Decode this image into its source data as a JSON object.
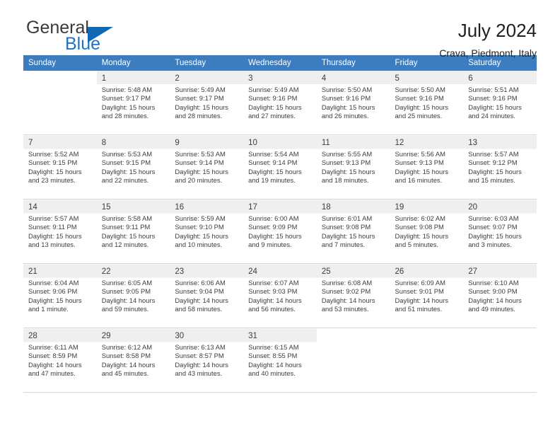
{
  "brand": {
    "name_top": "General",
    "name_bottom": "Blue",
    "triangle_color": "#1268b3",
    "blue_color": "#1c74c4"
  },
  "header": {
    "title": "July 2024",
    "subtitle": "Crava, Piedmont, Italy"
  },
  "theme": {
    "header_row_bg": "#3b7dbf",
    "header_row_text": "#ffffff",
    "daynum_band_bg": "#efefef",
    "grid_line": "#d8d8d8"
  },
  "weekdays": [
    "Sunday",
    "Monday",
    "Tuesday",
    "Wednesday",
    "Thursday",
    "Friday",
    "Saturday"
  ],
  "labels": {
    "sunrise_prefix": "Sunrise:",
    "sunset_prefix": "Sunset:",
    "daylight_prefix": "Daylight:"
  },
  "weeks": [
    [
      {
        "day": "",
        "l1": "",
        "l2": "",
        "l3": "",
        "l4": ""
      },
      {
        "day": "1",
        "l1": "Sunrise: 5:48 AM",
        "l2": "Sunset: 9:17 PM",
        "l3": "Daylight: 15 hours",
        "l4": "and 28 minutes."
      },
      {
        "day": "2",
        "l1": "Sunrise: 5:49 AM",
        "l2": "Sunset: 9:17 PM",
        "l3": "Daylight: 15 hours",
        "l4": "and 28 minutes."
      },
      {
        "day": "3",
        "l1": "Sunrise: 5:49 AM",
        "l2": "Sunset: 9:16 PM",
        "l3": "Daylight: 15 hours",
        "l4": "and 27 minutes."
      },
      {
        "day": "4",
        "l1": "Sunrise: 5:50 AM",
        "l2": "Sunset: 9:16 PM",
        "l3": "Daylight: 15 hours",
        "l4": "and 26 minutes."
      },
      {
        "day": "5",
        "l1": "Sunrise: 5:50 AM",
        "l2": "Sunset: 9:16 PM",
        "l3": "Daylight: 15 hours",
        "l4": "and 25 minutes."
      },
      {
        "day": "6",
        "l1": "Sunrise: 5:51 AM",
        "l2": "Sunset: 9:16 PM",
        "l3": "Daylight: 15 hours",
        "l4": "and 24 minutes."
      }
    ],
    [
      {
        "day": "7",
        "l1": "Sunrise: 5:52 AM",
        "l2": "Sunset: 9:15 PM",
        "l3": "Daylight: 15 hours",
        "l4": "and 23 minutes."
      },
      {
        "day": "8",
        "l1": "Sunrise: 5:53 AM",
        "l2": "Sunset: 9:15 PM",
        "l3": "Daylight: 15 hours",
        "l4": "and 22 minutes."
      },
      {
        "day": "9",
        "l1": "Sunrise: 5:53 AM",
        "l2": "Sunset: 9:14 PM",
        "l3": "Daylight: 15 hours",
        "l4": "and 20 minutes."
      },
      {
        "day": "10",
        "l1": "Sunrise: 5:54 AM",
        "l2": "Sunset: 9:14 PM",
        "l3": "Daylight: 15 hours",
        "l4": "and 19 minutes."
      },
      {
        "day": "11",
        "l1": "Sunrise: 5:55 AM",
        "l2": "Sunset: 9:13 PM",
        "l3": "Daylight: 15 hours",
        "l4": "and 18 minutes."
      },
      {
        "day": "12",
        "l1": "Sunrise: 5:56 AM",
        "l2": "Sunset: 9:13 PM",
        "l3": "Daylight: 15 hours",
        "l4": "and 16 minutes."
      },
      {
        "day": "13",
        "l1": "Sunrise: 5:57 AM",
        "l2": "Sunset: 9:12 PM",
        "l3": "Daylight: 15 hours",
        "l4": "and 15 minutes."
      }
    ],
    [
      {
        "day": "14",
        "l1": "Sunrise: 5:57 AM",
        "l2": "Sunset: 9:11 PM",
        "l3": "Daylight: 15 hours",
        "l4": "and 13 minutes."
      },
      {
        "day": "15",
        "l1": "Sunrise: 5:58 AM",
        "l2": "Sunset: 9:11 PM",
        "l3": "Daylight: 15 hours",
        "l4": "and 12 minutes."
      },
      {
        "day": "16",
        "l1": "Sunrise: 5:59 AM",
        "l2": "Sunset: 9:10 PM",
        "l3": "Daylight: 15 hours",
        "l4": "and 10 minutes."
      },
      {
        "day": "17",
        "l1": "Sunrise: 6:00 AM",
        "l2": "Sunset: 9:09 PM",
        "l3": "Daylight: 15 hours",
        "l4": "and 9 minutes."
      },
      {
        "day": "18",
        "l1": "Sunrise: 6:01 AM",
        "l2": "Sunset: 9:08 PM",
        "l3": "Daylight: 15 hours",
        "l4": "and 7 minutes."
      },
      {
        "day": "19",
        "l1": "Sunrise: 6:02 AM",
        "l2": "Sunset: 9:08 PM",
        "l3": "Daylight: 15 hours",
        "l4": "and 5 minutes."
      },
      {
        "day": "20",
        "l1": "Sunrise: 6:03 AM",
        "l2": "Sunset: 9:07 PM",
        "l3": "Daylight: 15 hours",
        "l4": "and 3 minutes."
      }
    ],
    [
      {
        "day": "21",
        "l1": "Sunrise: 6:04 AM",
        "l2": "Sunset: 9:06 PM",
        "l3": "Daylight: 15 hours",
        "l4": "and 1 minute."
      },
      {
        "day": "22",
        "l1": "Sunrise: 6:05 AM",
        "l2": "Sunset: 9:05 PM",
        "l3": "Daylight: 14 hours",
        "l4": "and 59 minutes."
      },
      {
        "day": "23",
        "l1": "Sunrise: 6:06 AM",
        "l2": "Sunset: 9:04 PM",
        "l3": "Daylight: 14 hours",
        "l4": "and 58 minutes."
      },
      {
        "day": "24",
        "l1": "Sunrise: 6:07 AM",
        "l2": "Sunset: 9:03 PM",
        "l3": "Daylight: 14 hours",
        "l4": "and 56 minutes."
      },
      {
        "day": "25",
        "l1": "Sunrise: 6:08 AM",
        "l2": "Sunset: 9:02 PM",
        "l3": "Daylight: 14 hours",
        "l4": "and 53 minutes."
      },
      {
        "day": "26",
        "l1": "Sunrise: 6:09 AM",
        "l2": "Sunset: 9:01 PM",
        "l3": "Daylight: 14 hours",
        "l4": "and 51 minutes."
      },
      {
        "day": "27",
        "l1": "Sunrise: 6:10 AM",
        "l2": "Sunset: 9:00 PM",
        "l3": "Daylight: 14 hours",
        "l4": "and 49 minutes."
      }
    ],
    [
      {
        "day": "28",
        "l1": "Sunrise: 6:11 AM",
        "l2": "Sunset: 8:59 PM",
        "l3": "Daylight: 14 hours",
        "l4": "and 47 minutes."
      },
      {
        "day": "29",
        "l1": "Sunrise: 6:12 AM",
        "l2": "Sunset: 8:58 PM",
        "l3": "Daylight: 14 hours",
        "l4": "and 45 minutes."
      },
      {
        "day": "30",
        "l1": "Sunrise: 6:13 AM",
        "l2": "Sunset: 8:57 PM",
        "l3": "Daylight: 14 hours",
        "l4": "and 43 minutes."
      },
      {
        "day": "31",
        "l1": "Sunrise: 6:15 AM",
        "l2": "Sunset: 8:55 PM",
        "l3": "Daylight: 14 hours",
        "l4": "and 40 minutes."
      },
      {
        "day": "",
        "l1": "",
        "l2": "",
        "l3": "",
        "l4": ""
      },
      {
        "day": "",
        "l1": "",
        "l2": "",
        "l3": "",
        "l4": ""
      },
      {
        "day": "",
        "l1": "",
        "l2": "",
        "l3": "",
        "l4": ""
      }
    ]
  ]
}
